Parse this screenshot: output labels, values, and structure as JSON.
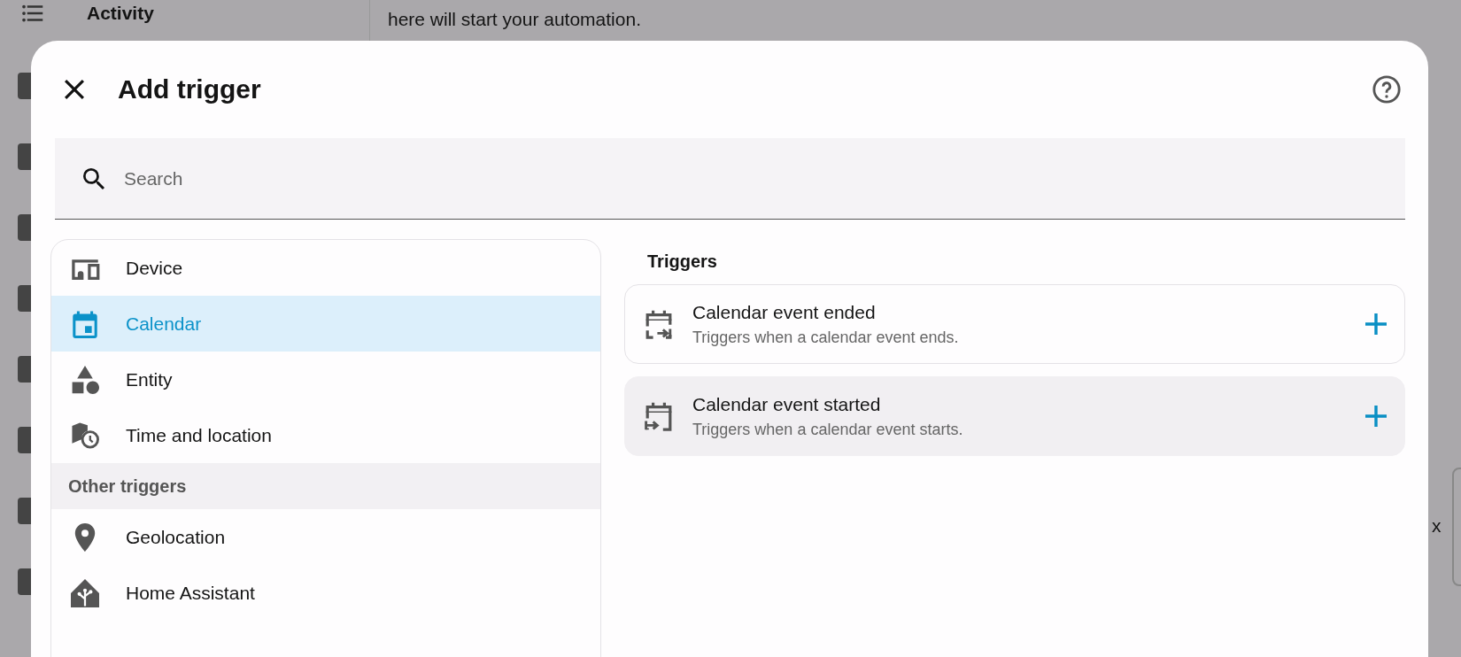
{
  "background": {
    "sidebar_item": "Activity",
    "description": "here will start your automation.",
    "side_fragment": "x"
  },
  "dialog": {
    "title": "Add trigger",
    "search": {
      "placeholder": "Search"
    },
    "groups": [
      {
        "items": [
          {
            "label": "Device",
            "kind": "device",
            "selected": false
          },
          {
            "label": "Calendar",
            "kind": "calendar",
            "selected": true
          },
          {
            "label": "Entity",
            "kind": "entity",
            "selected": false
          },
          {
            "label": "Time and location",
            "kind": "time-location",
            "selected": false
          }
        ]
      },
      {
        "header": "Other triggers",
        "items": [
          {
            "label": "Geolocation",
            "kind": "geolocation",
            "selected": false
          },
          {
            "label": "Home Assistant",
            "kind": "home-assistant",
            "selected": false
          }
        ]
      }
    ],
    "section_title": "Triggers",
    "triggers": [
      {
        "title": "Calendar event ended",
        "description": "Triggers when a calendar event ends.",
        "kind": "calendar-end",
        "highlighted": false
      },
      {
        "title": "Calendar event started",
        "description": "Triggers when a calendar event starts.",
        "kind": "calendar-start",
        "highlighted": true
      }
    ]
  }
}
